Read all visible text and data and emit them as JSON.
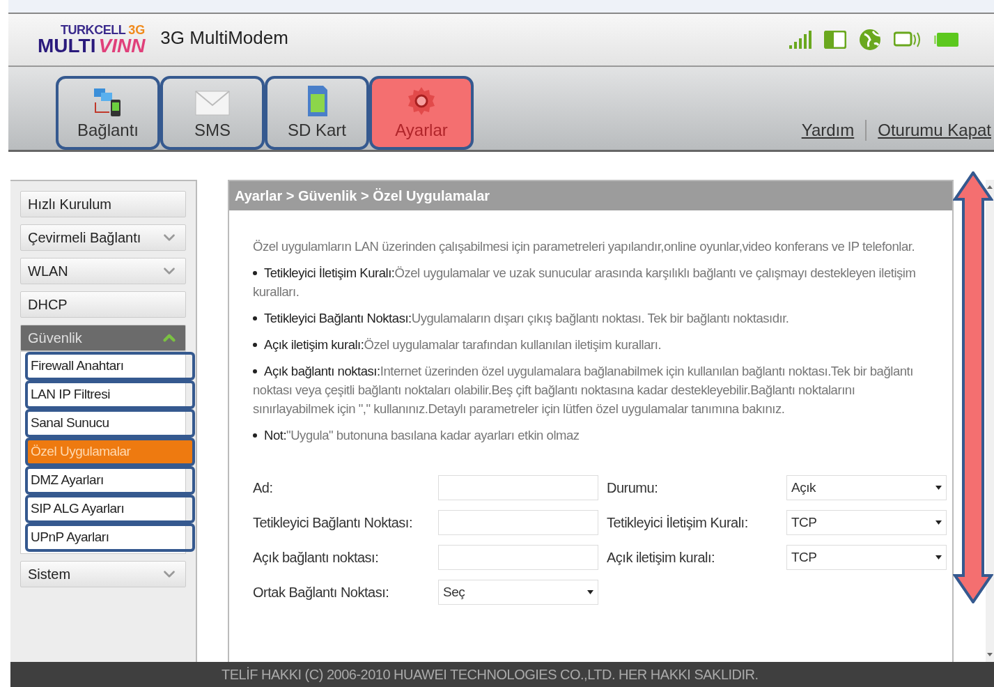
{
  "logo": {
    "brand": "TURKCELL",
    "badge": "3G",
    "product_left": "MULTI",
    "product_right": "VINN"
  },
  "app_title": "3G MultiModem",
  "tabs": [
    {
      "label": "Bağlantı",
      "kind": "connection",
      "selected": false,
      "highlighted": true
    },
    {
      "label": "SMS",
      "kind": "sms",
      "selected": false,
      "highlighted": true
    },
    {
      "label": "SD Kart",
      "kind": "sdcard",
      "selected": false,
      "highlighted": true
    },
    {
      "label": "Ayarlar",
      "kind": "settings",
      "selected": true,
      "highlighted": true
    }
  ],
  "header_links": [
    "Yardım",
    "Oturumu Kapat"
  ],
  "sidebar": {
    "items": [
      {
        "label": "Hızlı Kurulum",
        "kind": "plain"
      },
      {
        "label": "Çevirmeli Bağlantı",
        "kind": "group",
        "expanded": false
      },
      {
        "label": "WLAN",
        "kind": "group",
        "expanded": false
      },
      {
        "label": "DHCP",
        "kind": "plain"
      },
      {
        "label": "Güvenlik",
        "kind": "group",
        "expanded": true,
        "children": [
          {
            "label": "Firewall Anahtarı",
            "selected": false,
            "highlighted": true
          },
          {
            "label": "LAN IP Filtresi",
            "selected": false,
            "highlighted": true
          },
          {
            "label": "Sanal Sunucu",
            "selected": false,
            "highlighted": true
          },
          {
            "label": "Özel Uygulamalar",
            "selected": true,
            "highlighted": true
          },
          {
            "label": "DMZ Ayarları",
            "selected": false,
            "highlighted": true
          },
          {
            "label": "SIP ALG Ayarları",
            "selected": false,
            "highlighted": true
          },
          {
            "label": "UPnP Ayarları",
            "selected": false,
            "highlighted": true
          }
        ]
      },
      {
        "label": "Sistem",
        "kind": "group",
        "expanded": false
      }
    ]
  },
  "breadcrumb": "Ayarlar > Güvenlik > Özel Uygulamalar",
  "intro": "Özel uygulamların LAN üzerinden çalışabilmesi için parametreleri yapılandır,online oyunlar,video konferans ve IP telefonlar.",
  "bullets": [
    "**Tetikleyici İletişim Kuralı:**Özel uygulamalar ve uzak sunucular arasında karşılıklı bağlantı ve çalışmayı destekleyen iletişim kuralları.",
    "**Tetikleyici Bağlantı Noktası:**Uygulamaların dışarı çıkış bağlantı noktası. Tek bir bağlantı noktasıdır.",
    "**Açık iletişim kuralı:**Özel uygulamalar tarafından kullanılan iletişim kuralları.",
    "**Açık bağlantı noktası:**Internet üzerinden özel uygulamalara bağlanabilmek için kullanılan bağlantı noktası.Tek bir bağlantı noktası veya çeşitli bağlantı noktaları olabilir.Beş çift bağlantı noktasına kadar destekleyebilir.Bağlantı noktalarını sınırlayabilmek için \",\" kullanınız.Detaylı parametreler için lütfen özel uygulamalar tanımına bakınız.",
    "**Not:**\"Uygula\" butonuna basılana kadar ayarları etkin olmaz"
  ],
  "form": {
    "fields": [
      {
        "label": "Ad:",
        "kind": "text"
      },
      {
        "label": "Durumu:",
        "kind": "select",
        "value": "Açık"
      },
      {
        "label": "Tetikleyici Bağlantı Noktası:",
        "kind": "text"
      },
      {
        "label": "Tetikleyici İletişim Kuralı:",
        "kind": "select",
        "value": "TCP"
      },
      {
        "label": "Açık bağlantı noktası:",
        "kind": "text"
      },
      {
        "label": "Açık iletişim kuralı:",
        "kind": "select",
        "value": "TCP"
      },
      {
        "label": "Ortak Bağlantı Noktası:",
        "kind": "select",
        "value": "Seç"
      }
    ]
  },
  "footer": "TELİF HAKKI (C) 2006-2010 HUAWEI TECHNOLOGIES CO.,LTD. HER HAKKI SAKLIDIR."
}
